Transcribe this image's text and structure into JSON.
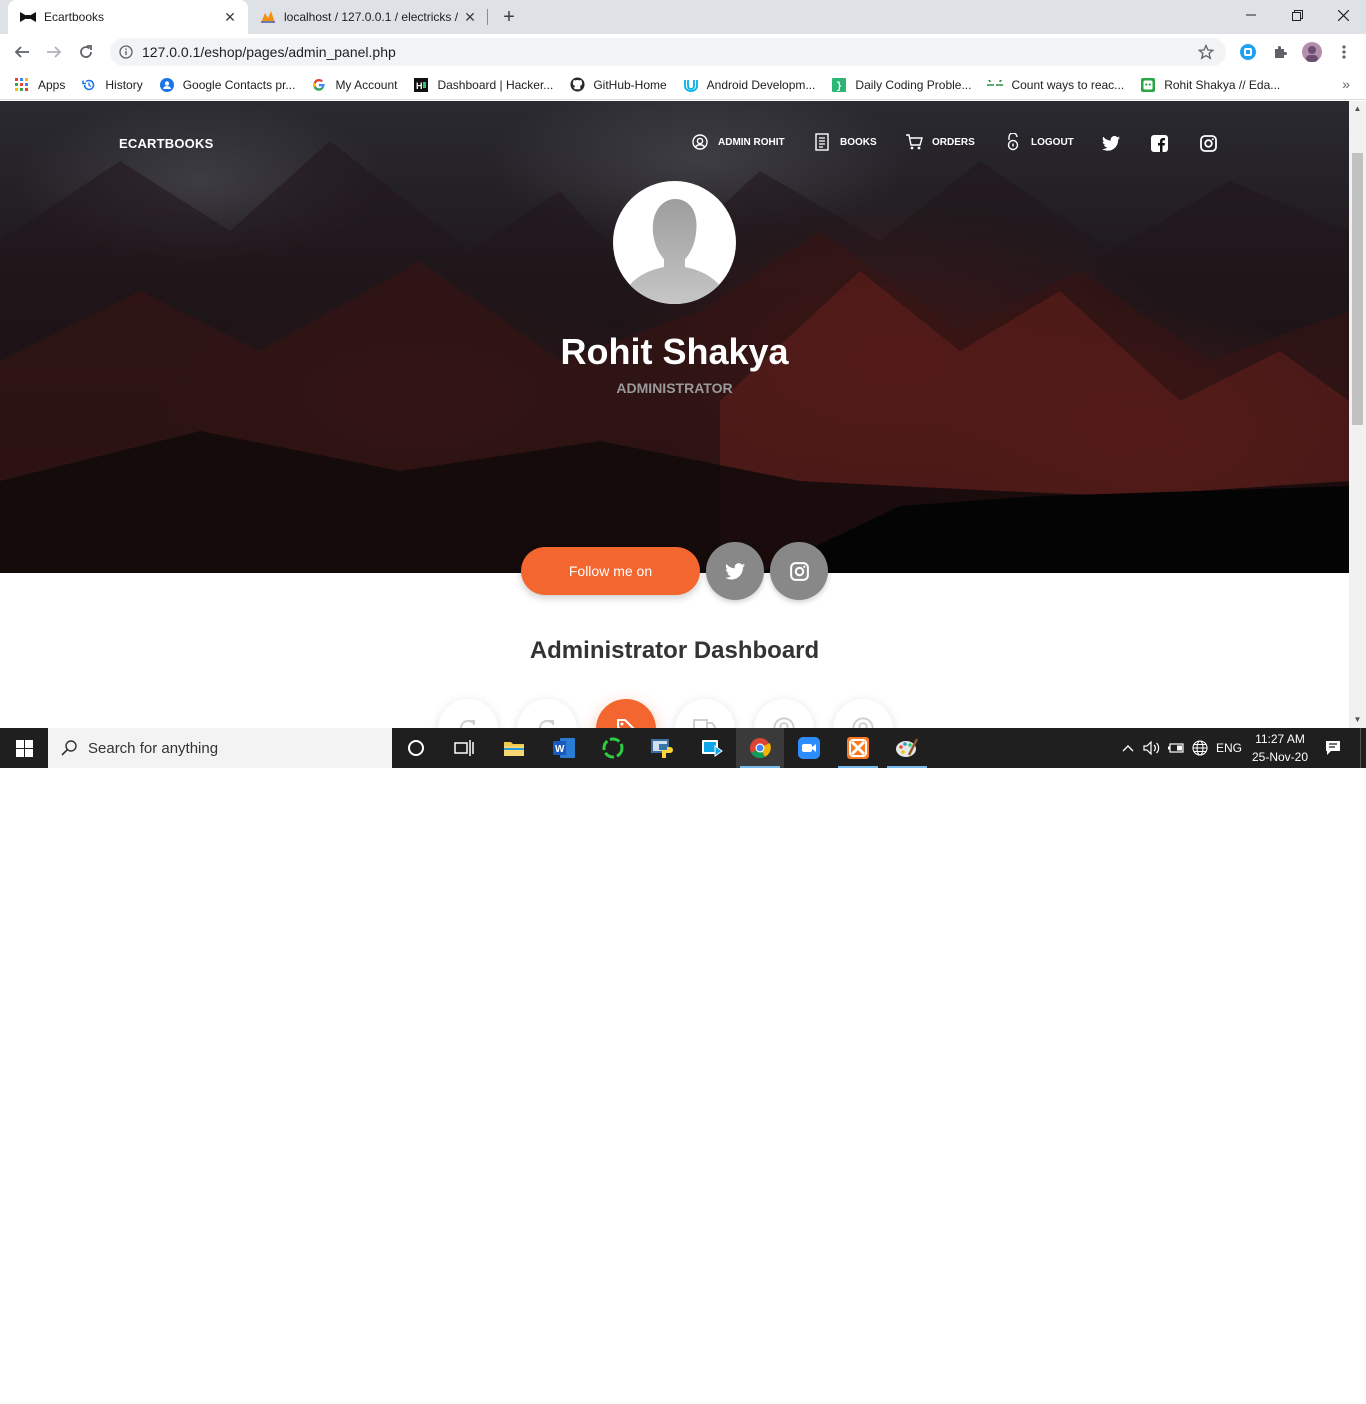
{
  "browser": {
    "tabs": [
      {
        "title": "Ecartbooks",
        "active": true
      },
      {
        "title": "localhost / 127.0.0.1 / electricks /",
        "active": false
      }
    ],
    "new_tab": "+",
    "url": "127.0.0.1/eshop/pages/admin_panel.php",
    "bookmarks": [
      {
        "label": "Apps",
        "icon": "apps-grid-icon"
      },
      {
        "label": "History",
        "icon": "history-icon"
      },
      {
        "label": "Google Contacts pr...",
        "icon": "contacts-icon"
      },
      {
        "label": "My Account",
        "icon": "google-icon"
      },
      {
        "label": "Dashboard | Hacker...",
        "icon": "hackerrank-icon"
      },
      {
        "label": "GitHub-Home",
        "icon": "github-icon"
      },
      {
        "label": "Android Developm...",
        "icon": "udacity-icon"
      },
      {
        "label": "Daily Coding Proble...",
        "icon": "daily-coding-icon"
      },
      {
        "label": "Count ways to reac...",
        "icon": "geeksforgeeks-icon"
      },
      {
        "label": "Rohit Shakya // Eda...",
        "icon": "edabit-icon"
      }
    ],
    "bookmarks_more": "»"
  },
  "site": {
    "brand": "ECARTBOOKS",
    "nav": [
      {
        "label": "ADMIN ROHIT",
        "icon": "user-circle-icon"
      },
      {
        "label": "BOOKS",
        "icon": "book-icon"
      },
      {
        "label": "ORDERS",
        "icon": "cart-icon"
      },
      {
        "label": "LOGOUT",
        "icon": "lock-icon"
      }
    ],
    "social": [
      "twitter-icon",
      "facebook-icon",
      "instagram-icon"
    ],
    "profile": {
      "name": "Rohit Shakya",
      "role": "ADMINISTRATOR"
    },
    "follow_label": "Follow me on",
    "dashboard_title": "Administrator Dashboard",
    "accent": "#f4662f"
  },
  "taskbar": {
    "search_placeholder": "Search for anything",
    "language": "ENG",
    "time": "11:27 AM",
    "date": "25-Nov-20"
  }
}
